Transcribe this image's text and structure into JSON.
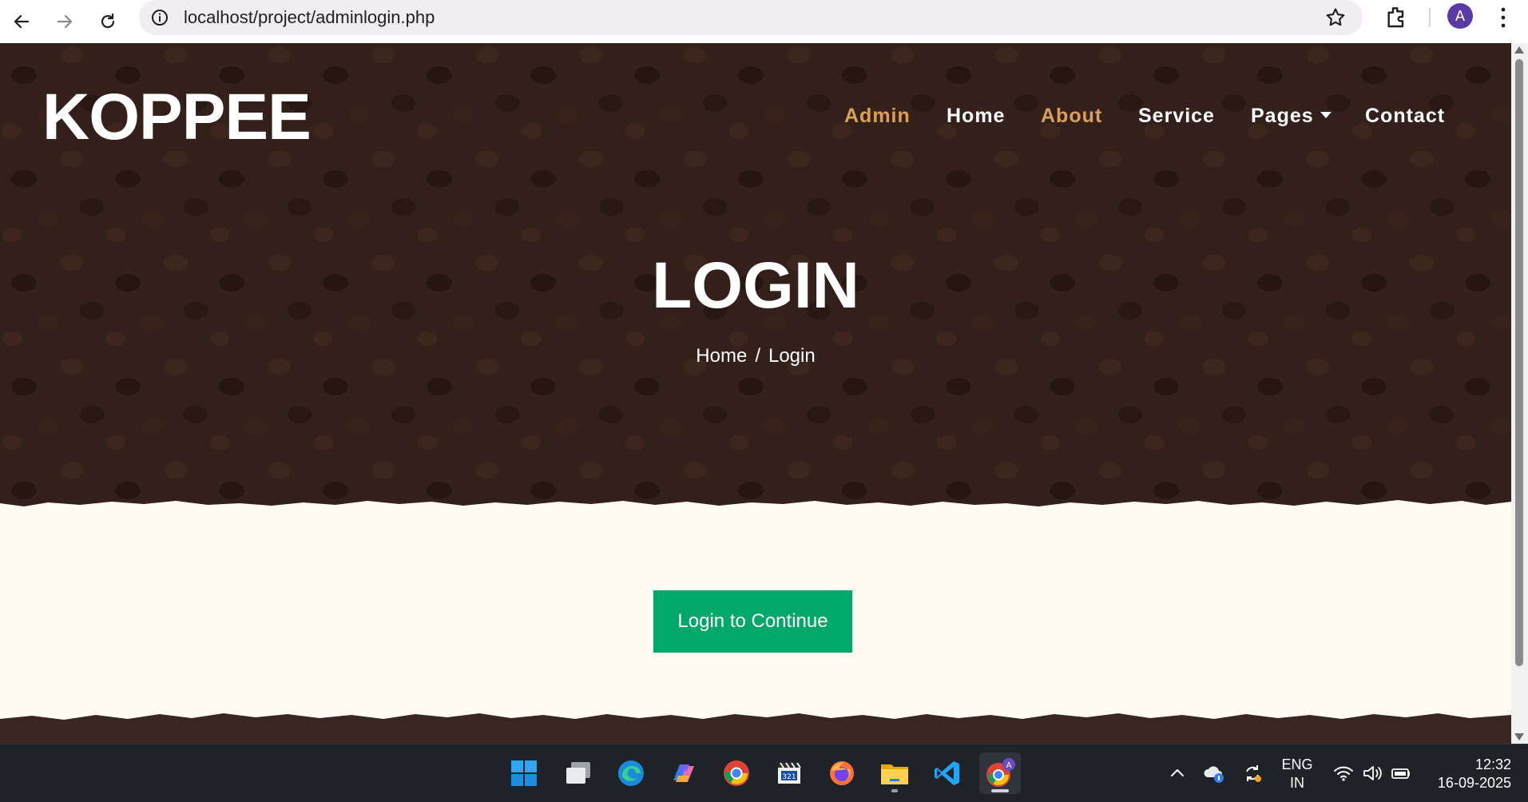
{
  "browser": {
    "url": "localhost/project/adminlogin.php",
    "profile_initial": "A"
  },
  "site": {
    "brand": "KOPPEE",
    "nav": [
      {
        "label": "Admin",
        "active": true
      },
      {
        "label": "Home",
        "active": false
      },
      {
        "label": "About",
        "active": true
      },
      {
        "label": "Service",
        "active": false
      },
      {
        "label": "Pages",
        "active": false,
        "dropdown": true
      },
      {
        "label": "Contact",
        "active": false
      }
    ],
    "hero": {
      "title": "LOGIN",
      "breadcrumb_home": "Home",
      "breadcrumb_sep": "/",
      "breadcrumb_current": "Login"
    },
    "cta_label": "Login to Continue"
  },
  "colors": {
    "accent": "#da9f5b",
    "cta": "#02a86a",
    "hero_bg": "#3a2620",
    "cream": "#fffaf2"
  },
  "taskbar": {
    "apps": [
      "windows-start-icon",
      "task-view-icon",
      "edge-icon",
      "copilot-icon",
      "chrome-icon",
      "media-player-icon",
      "firefox-icon",
      "file-explorer-icon",
      "vscode-icon",
      "chrome-profile-icon"
    ],
    "lang_line1": "ENG",
    "lang_line2": "IN",
    "time": "12:32",
    "date": "16-09-2025"
  }
}
